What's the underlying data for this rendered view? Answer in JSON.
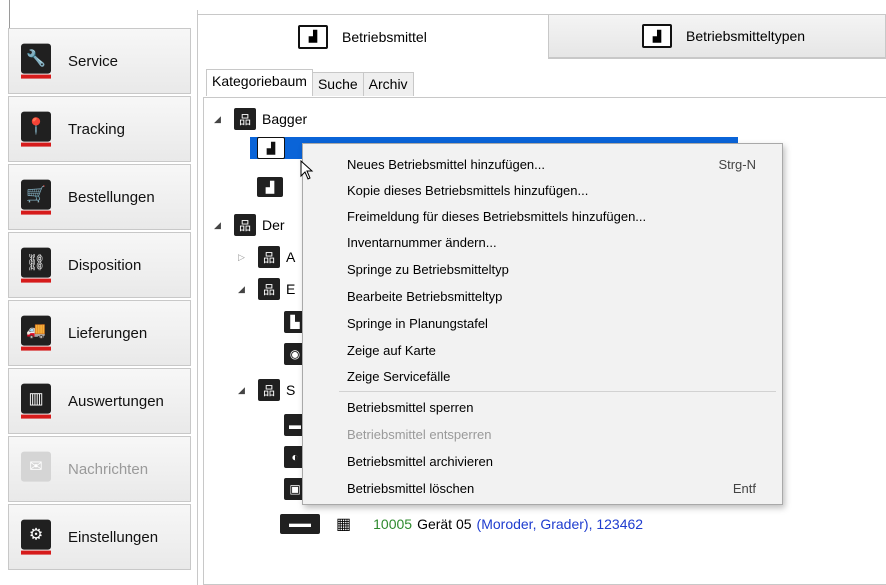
{
  "nav": {
    "items": [
      {
        "label": "Service",
        "icon": "wrench-icon",
        "glyph": "🔧",
        "disabled": false
      },
      {
        "label": "Tracking",
        "icon": "location-pin-icon",
        "glyph": "📍",
        "disabled": false
      },
      {
        "label": "Bestellungen",
        "icon": "cart-icon",
        "glyph": "🛒",
        "disabled": false
      },
      {
        "label": "Disposition",
        "icon": "schedule-icon",
        "glyph": "⛓",
        "disabled": false
      },
      {
        "label": "Lieferungen",
        "icon": "truck-icon",
        "glyph": "🚚",
        "disabled": false
      },
      {
        "label": "Auswertungen",
        "icon": "bar-chart-icon",
        "glyph": "▥",
        "disabled": false
      },
      {
        "label": "Nachrichten",
        "icon": "mail-icon",
        "glyph": "✉",
        "disabled": true
      },
      {
        "label": "Einstellungen",
        "icon": "gear-icon",
        "glyph": "⚙",
        "disabled": false
      }
    ]
  },
  "top_tabs": {
    "active": {
      "label": "Betriebsmittel",
      "icon": "excavator-icon"
    },
    "inactive": {
      "label": "Betriebsmitteltypen",
      "icon": "excavator-type-icon"
    }
  },
  "sub_tabs": [
    "Kategoriebaum",
    "Suche",
    "Archiv"
  ],
  "tree": {
    "bagger": "Bagger",
    "den_prefix": "Der",
    "row_a": "A",
    "row_b": "E",
    "row_s": "S",
    "last_item": {
      "number": "10005",
      "name": "Gerät 05",
      "meta": "(Moroder, Grader), 123462"
    }
  },
  "context_menu": {
    "items": [
      {
        "label": "Neues Betriebsmittel hinzufügen...",
        "shortcut": "Strg-N",
        "disabled": false
      },
      {
        "label": "Kopie dieses Betriebsmittels hinzufügen...",
        "shortcut": "",
        "disabled": false
      },
      {
        "label": "Freimeldung für dieses Betriebsmittels hinzufügen...",
        "shortcut": "",
        "disabled": false
      },
      {
        "label": "Inventarnummer ändern...",
        "shortcut": "",
        "disabled": false
      },
      {
        "label": "Springe zu Betriebsmitteltyp",
        "shortcut": "",
        "disabled": false
      },
      {
        "label": "Bearbeite Betriebsmitteltyp",
        "shortcut": "",
        "disabled": false
      },
      {
        "label": "Springe in Planungstafel",
        "shortcut": "",
        "disabled": false
      },
      {
        "label": "Zeige auf Karte",
        "shortcut": "",
        "disabled": false
      },
      {
        "label": "Zeige Servicefälle",
        "shortcut": "",
        "disabled": false
      },
      {
        "label": "Betriebsmittel sperren",
        "shortcut": "",
        "disabled": false
      },
      {
        "label": "Betriebsmittel entsperren",
        "shortcut": "",
        "disabled": true
      },
      {
        "label": "Betriebsmittel archivieren",
        "shortcut": "",
        "disabled": false
      },
      {
        "label": "Betriebsmittel löschen",
        "shortcut": "Entf",
        "disabled": false
      }
    ]
  },
  "colors": {
    "accent_red": "#d61b1b",
    "selection_blue": "#0a64d8",
    "number_green": "#2e8a2e",
    "meta_blue": "#1e3ccf"
  }
}
